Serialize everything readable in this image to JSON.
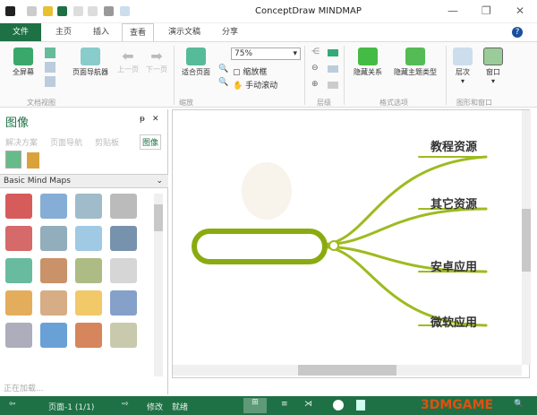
{
  "window": {
    "title": "ConceptDraw MINDMAP",
    "minimize": "—",
    "restore": "❐",
    "close": "✕"
  },
  "tabs": [
    "文件",
    "主页",
    "插入",
    "查看",
    "演示文稿",
    "分享"
  ],
  "ribbon": {
    "fullscreen": "全屏幕",
    "page_navigator": "页面导航器",
    "prev_page": "上一页",
    "next_page": "下一页",
    "fit_page": "适合页面",
    "zoom_value": "75%",
    "zoom_box": "缩放框",
    "manual_scroll": "手动滚动",
    "hide_relations": "隐藏关系",
    "hide_topic_types": "隐藏主题类型",
    "layers": "层次",
    "window": "窗口",
    "groups": [
      "文档视图",
      "缩放",
      "层级",
      "格式选项",
      "图形和窗口"
    ]
  },
  "panel": {
    "title": "图像",
    "pin": "ᵽ",
    "close": "✕",
    "tabs": [
      "解决方案",
      "页面导航",
      "剪贴板",
      "图像"
    ],
    "library": "Basic Mind Maps",
    "footer": "正在加载..."
  },
  "mindmap": {
    "topics": [
      "教程资源",
      "其它资源",
      "安卓应用",
      "微软应用"
    ],
    "branch_color": "#9dbb1f"
  },
  "status": {
    "page": "页面-1 (1/1)",
    "modified": "修改",
    "ready": "就绪"
  }
}
